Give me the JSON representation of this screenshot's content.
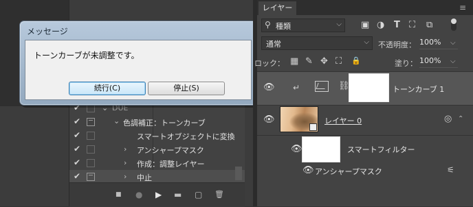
{
  "dialog": {
    "title": "メッセージ",
    "message": "トーンカーブが未調整です。",
    "continue_label": "続行(C)",
    "stop_label": "停止(S)"
  },
  "actions_panel": {
    "rows": [
      {
        "label": "DUE",
        "checked": true
      },
      {
        "label": "色調補正：トーンカーブ",
        "checked": true
      },
      {
        "label": "スマートオブジェクトに変換",
        "checked": true
      },
      {
        "label": "アンシャープマスク",
        "checked": true
      },
      {
        "label": "作成：調整レイヤー",
        "checked": true
      },
      {
        "label": "中止",
        "checked": true
      }
    ],
    "check_glyph": "✔",
    "buttons": {
      "stop": "■",
      "record": "●",
      "play": "▶",
      "folder": "▬",
      "new": "▢",
      "delete": "🗑"
    }
  },
  "layers_panel": {
    "tab_label": "レイヤー",
    "menu_icon": "≡",
    "filter": {
      "label": "種類",
      "icons": [
        "▣",
        "◑",
        "T",
        "⛶",
        "⧉"
      ]
    },
    "blend_mode": "通常",
    "opacity_label": "不透明度：",
    "opacity_value": "100%",
    "lock_label": "ロック：",
    "lock_icons": [
      "▦",
      "✎",
      "✥",
      "⛶",
      "🔒"
    ],
    "fill_label": "塗り：",
    "fill_value": "100%",
    "layers": [
      {
        "name": "トーンカーブ 1",
        "type": "adjustment",
        "selected": true
      },
      {
        "name": "レイヤー 0",
        "type": "smart-object"
      },
      {
        "name": "スマートフィルター",
        "type": "smart-filter"
      },
      {
        "name": "アンシャープマスク",
        "type": "filter"
      }
    ],
    "eye_glyph": "👁",
    "chain_glyph": "⛓",
    "arrow_glyph": "↵"
  }
}
